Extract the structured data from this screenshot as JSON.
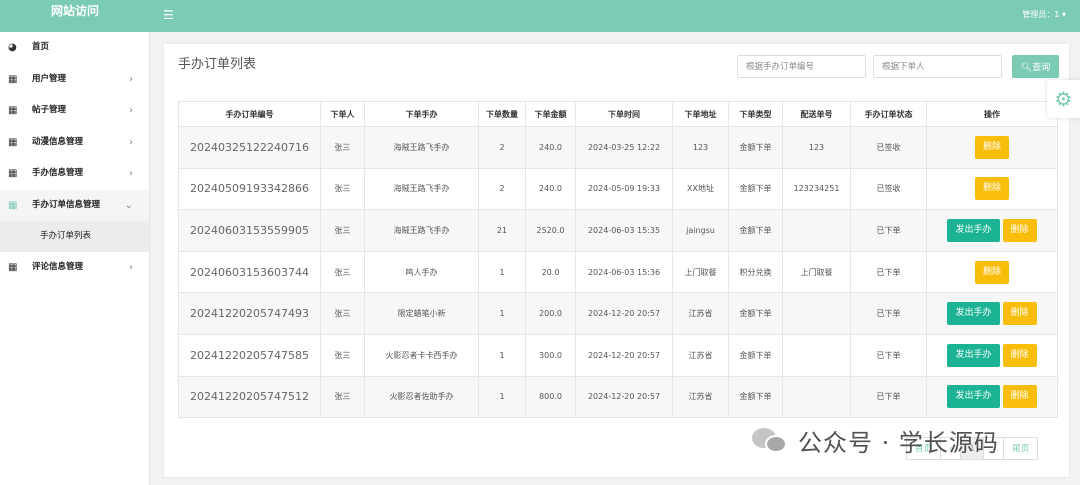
{
  "header": {
    "brand": "网站访问",
    "menu_icon": "hamburger-icon",
    "admin": "管理员：1 ▾"
  },
  "sidebar": {
    "items": [
      {
        "label": "首页",
        "icon": "dashboard-icon",
        "chevron": ""
      },
      {
        "label": "用户管理",
        "icon": "table-icon",
        "chevron": "›"
      },
      {
        "label": "帖子管理",
        "icon": "table-icon",
        "chevron": "›"
      },
      {
        "label": "动漫信息管理",
        "icon": "table-icon",
        "chevron": "›"
      },
      {
        "label": "手办信息管理",
        "icon": "table-icon",
        "chevron": "›"
      },
      {
        "label": "手办订单信息管理",
        "icon": "table-icon",
        "chevron": "⌄"
      },
      {
        "label": "评论信息管理",
        "icon": "table-icon",
        "chevron": "›"
      }
    ],
    "subitem": "手办订单列表"
  },
  "main": {
    "title": "手办订单列表",
    "search_order_placeholder": "根据手办订单编号",
    "search_user_placeholder": "根据下单人",
    "search_button": "查询",
    "settings_icon": "gear-icon"
  },
  "table": {
    "headers": [
      "手办订单编号",
      "下单人",
      "下单手办",
      "下单数量",
      "下单金额",
      "下单时间",
      "下单地址",
      "下单类型",
      "配送单号",
      "手办订单状态",
      "操作"
    ],
    "rows": [
      [
        "20240325122240716",
        "张三",
        "海贼王路飞手办",
        "2",
        "240.0",
        "2024-03-25 12:22",
        "123",
        "金额下单",
        "123",
        "已签收"
      ],
      [
        "20240509193342866",
        "张三",
        "海贼王路飞手办",
        "2",
        "240.0",
        "2024-05-09 19:33",
        "XX地址",
        "金额下单",
        "123234251",
        "已签收"
      ],
      [
        "20240603153559905",
        "张三",
        "海贼王路飞手办",
        "21",
        "2520.0",
        "2024-06-03 15:35",
        "jaingsu",
        "金额下单",
        "",
        "已下单"
      ],
      [
        "20240603153603744",
        "张三",
        "鸣人手办",
        "1",
        "20.0",
        "2024-06-03 15:36",
        "上门取餐",
        "积分兑换",
        "上门取餐",
        "已下单"
      ],
      [
        "20241220205747493",
        "张三",
        "限定蜡笔小新",
        "1",
        "200.0",
        "2024-12-20 20:57",
        "江苏省",
        "金额下单",
        "",
        "已下单"
      ],
      [
        "20241220205747585",
        "张三",
        "火影忍者卡卡西手办",
        "1",
        "300.0",
        "2024-12-20 20:57",
        "江苏省",
        "金额下单",
        "",
        "已下单"
      ],
      [
        "20241220205747512",
        "张三",
        "火影忍者佐助手办",
        "1",
        "800.0",
        "2024-12-20 20:57",
        "江苏省",
        "金额下单",
        "",
        "已下单"
      ]
    ],
    "ship_label": "发出手办",
    "delete_label": "删除"
  },
  "pagination": {
    "first": "首页",
    "prev": "‹",
    "current": "1",
    "next": "›",
    "last": "尾页"
  },
  "watermark": {
    "text": "公众号 · 学长源码"
  }
}
